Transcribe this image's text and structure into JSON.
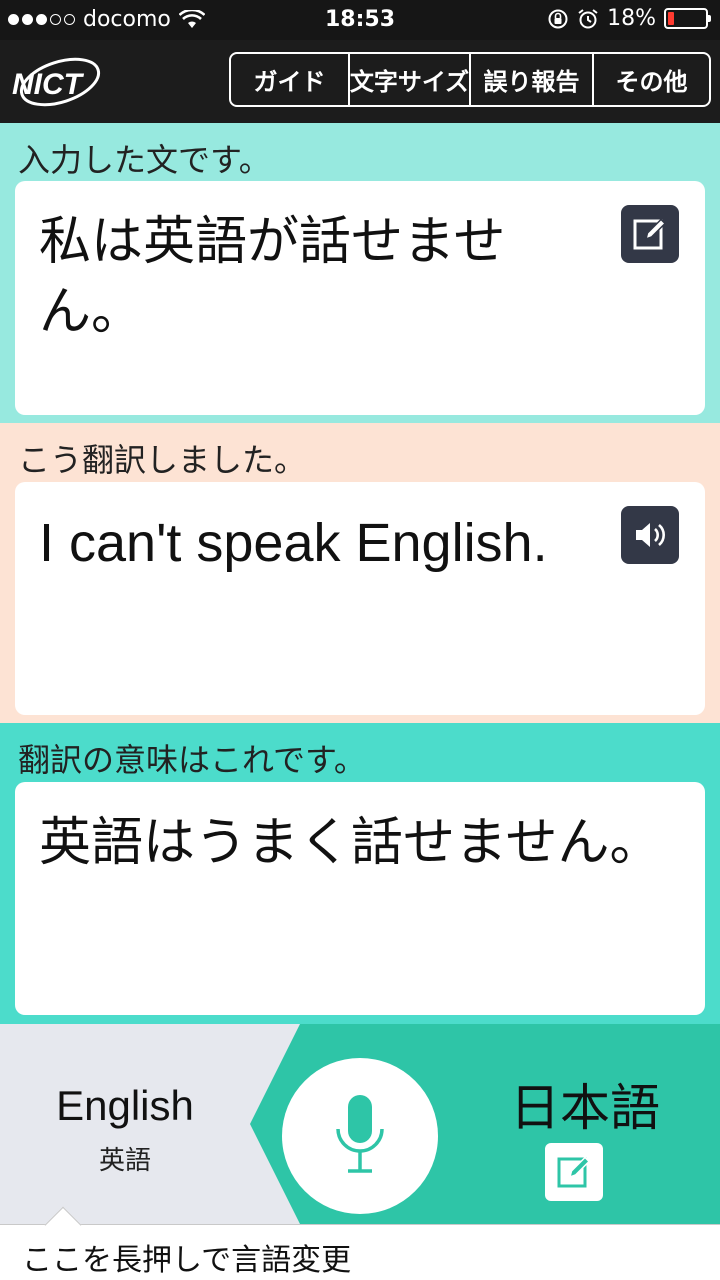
{
  "status_bar": {
    "carrier": "docomo",
    "time": "18:53",
    "battery_percent": "18%",
    "battery_level": 0.18,
    "signal_bars_filled": 3,
    "signal_bars_total": 5,
    "icons": [
      "wifi-icon",
      "orientation-lock-icon",
      "alarm-icon"
    ]
  },
  "header": {
    "logo_text": "NICT",
    "nav": {
      "guide": "ガイド",
      "font_size": "文字サイズ",
      "error_report": "誤り報告",
      "other": "その他"
    }
  },
  "input_panel": {
    "label": "入力した文です。",
    "text": "私は英語が話せません。",
    "icon": "edit-icon",
    "bg_color": "#97e9df"
  },
  "translation_panel": {
    "label": "こう翻訳しました。",
    "text": "I can't speak English.",
    "icon": "speaker-icon",
    "bg_color": "#fde3d4"
  },
  "back_translation_panel": {
    "label": "翻訳の意味はこれです。",
    "text": "英語はうまく話せません。",
    "bg_color": "#4cdccb"
  },
  "bottom": {
    "left_language": "English",
    "left_language_sub": "英語",
    "right_language": "日本語",
    "accent_color": "#2ec5a7",
    "mic_icon": "microphone-icon",
    "edit_icon": "edit-icon"
  },
  "hint": {
    "text": "ここを長押しで言語変更"
  }
}
